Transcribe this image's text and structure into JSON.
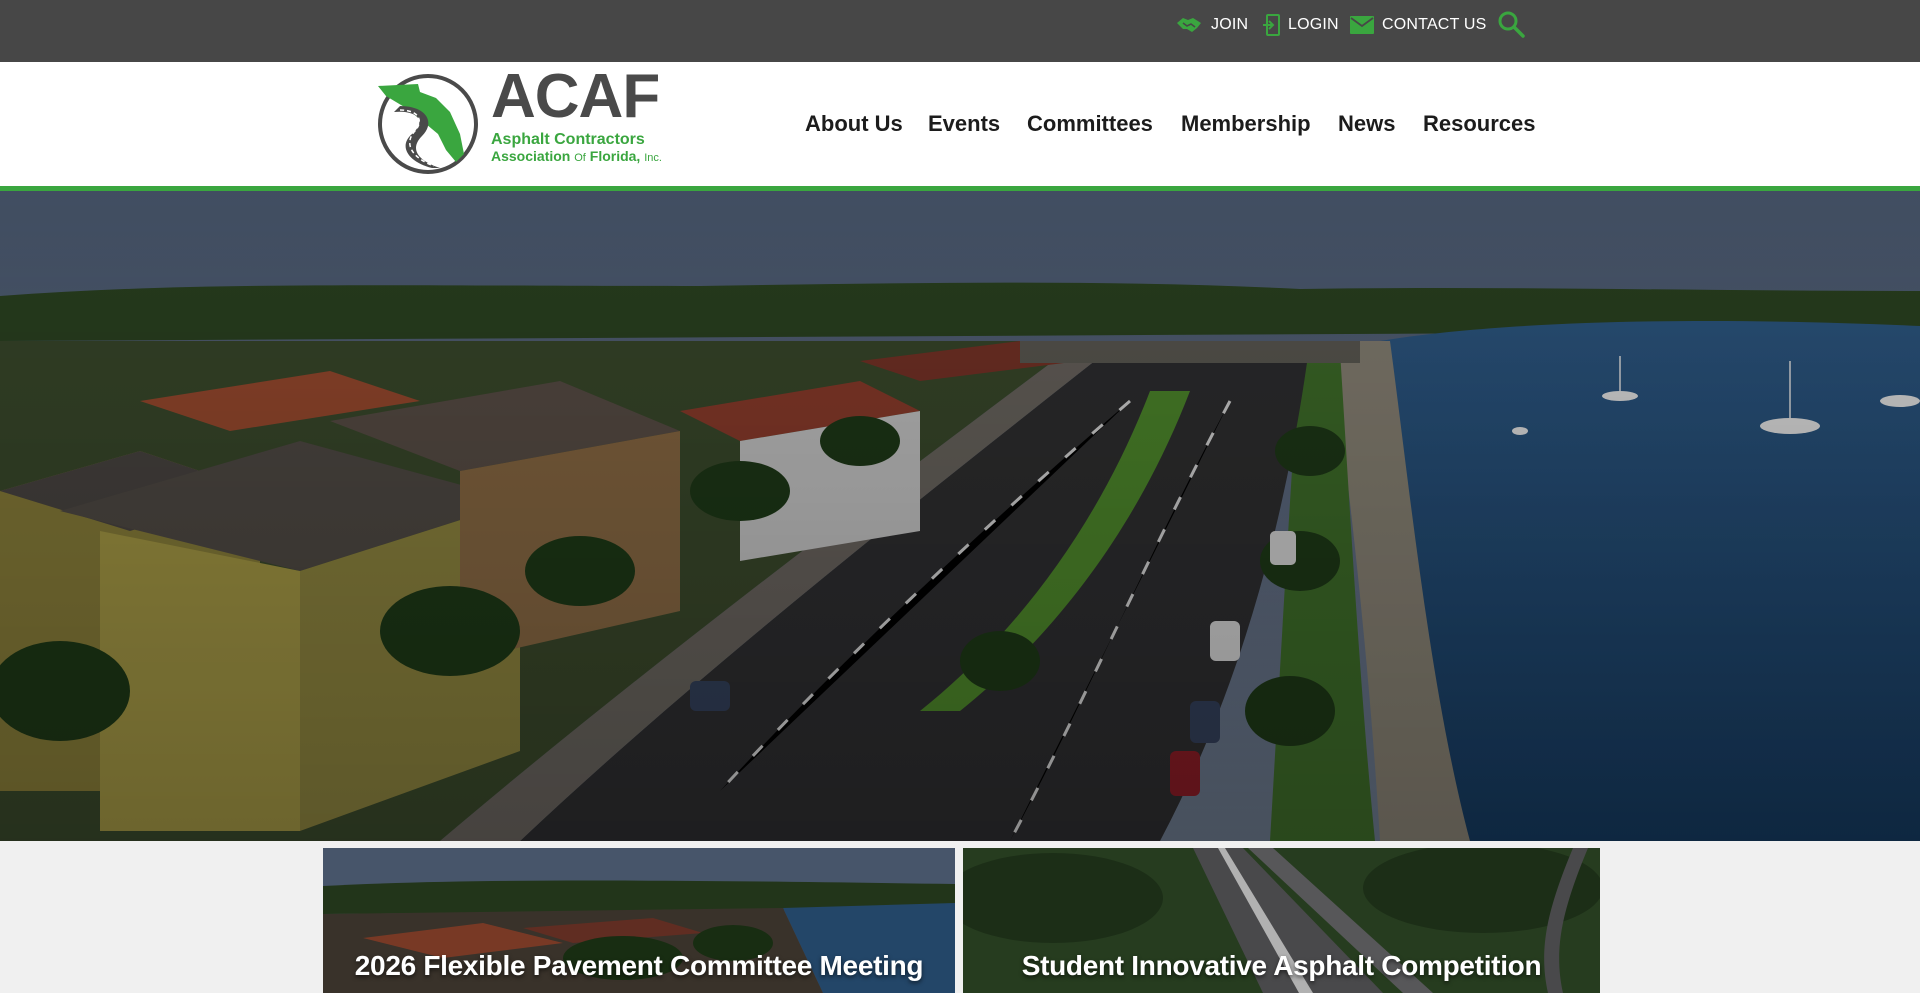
{
  "utility_bar": {
    "join_label": "JOIN",
    "join_icon": "handshake-icon",
    "login_label": "LOGIN",
    "login_icon": "login-icon",
    "contact_label": "CONTACT US",
    "contact_icon": "envelope-icon",
    "search_icon": "search-icon"
  },
  "logo": {
    "wordmark": "ACAF",
    "line1": "Asphalt Contractors",
    "line2_a": "Association",
    "line2_of": "Of",
    "line2_b": "Florida,",
    "line2_inc": "Inc."
  },
  "nav": {
    "items": [
      {
        "label": "About Us"
      },
      {
        "label": "Events"
      },
      {
        "label": "Committees"
      },
      {
        "label": "Membership"
      },
      {
        "label": "News"
      },
      {
        "label": "Resources"
      }
    ]
  },
  "cards": [
    {
      "title": "2026 Flexible Pavement Committee Meeting"
    },
    {
      "title": "Student Innovative Asphalt Competition"
    }
  ],
  "colors": {
    "brand_green": "#3aa63f",
    "topbar": "#474747",
    "nav_text": "#1c1c1c"
  }
}
